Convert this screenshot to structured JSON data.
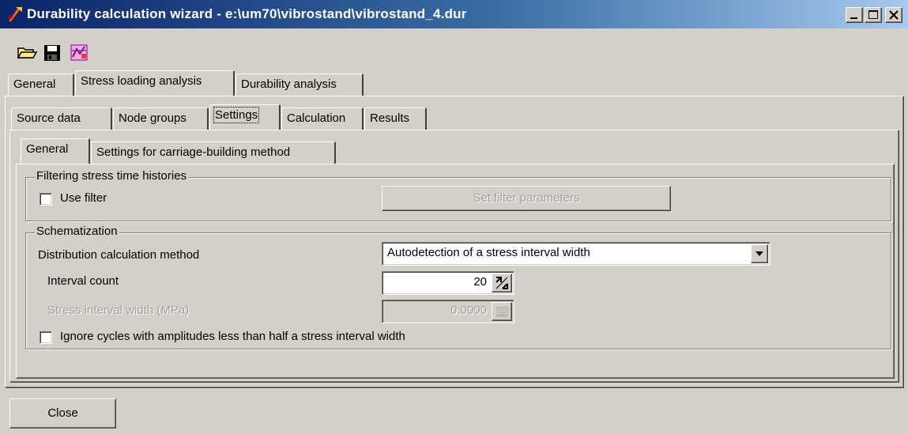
{
  "window": {
    "title": "Durability calculation wizard - e:\\um70\\vibrostand\\vibrostand_4.dur",
    "caption_buttons": [
      "minimize",
      "maximize",
      "close"
    ]
  },
  "toolbar": {
    "icons": [
      "open-folder-icon",
      "save-disk-icon",
      "wizard-chart-icon"
    ]
  },
  "main_tabs": [
    "General",
    "Stress loading analysis",
    "Durability analysis"
  ],
  "sub_tabs": [
    "Source data",
    "Node groups",
    "Settings",
    "Calculation",
    "Results"
  ],
  "settings_tabs": [
    "General",
    "Settings for carriage-building method"
  ],
  "filtering": {
    "legend": "Filtering stress time histories",
    "use_filter_label": "Use filter",
    "use_filter_checked": false,
    "set_filter_button": "Set filter parameters"
  },
  "schematization": {
    "legend": "Schematization",
    "method_label": "Distribution calculation method",
    "method_value": "Autodetection of a stress interval width",
    "interval_count_label": "Interval count",
    "interval_count_value": "20",
    "stress_width_label": "Stress interval width (MPa)",
    "stress_width_value": "0.0000",
    "ignore_label": "Ignore cycles with amplitudes less than half a stress interval width",
    "ignore_checked": false
  },
  "footer": {
    "close_button": "Close"
  },
  "colors": {
    "titlebar_start": "#0a246a",
    "titlebar_end": "#a6caf0",
    "face": "#d4d0c8"
  }
}
